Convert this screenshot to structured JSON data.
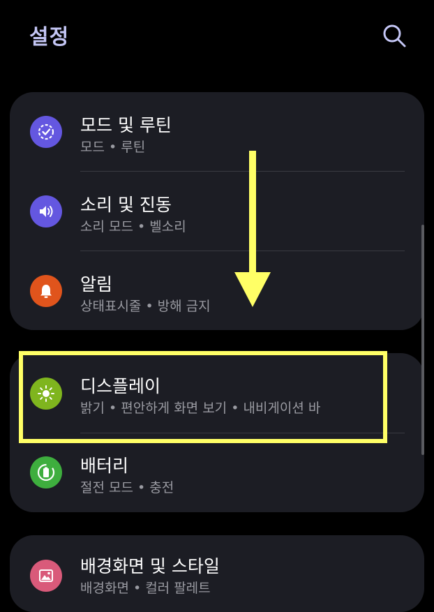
{
  "header": {
    "title": "설정",
    "search_icon": "search-icon"
  },
  "groups": [
    {
      "items": [
        {
          "title": "모드 및 루틴",
          "subtitle": "모드 • 루틴",
          "icon": "modes-routines-icon",
          "color": "#6457e0"
        },
        {
          "title": "소리 및 진동",
          "subtitle": "소리 모드 • 벨소리",
          "icon": "speaker-icon",
          "color": "#6457e0"
        },
        {
          "title": "알림",
          "subtitle": "상태표시줄 • 방해 금지",
          "icon": "bell-icon",
          "color": "#e0541c"
        }
      ]
    },
    {
      "items": [
        {
          "title": "디스플레이",
          "subtitle": "밝기 • 편안하게 화면 보기 • 내비게이션 바",
          "icon": "sun-icon",
          "color": "#7fb51e"
        },
        {
          "title": "배터리",
          "subtitle": "절전 모드 • 충전",
          "icon": "battery-icon",
          "color": "#3eae3e"
        }
      ]
    },
    {
      "items": [
        {
          "title": "배경화면 및 스타일",
          "subtitle": "배경화면 • 컬러 팔레트",
          "icon": "wallpaper-icon",
          "color": "#d95a7a"
        }
      ]
    }
  ],
  "annotations": {
    "arrow_color": "#ffff66",
    "highlight_color": "#ffff66"
  }
}
